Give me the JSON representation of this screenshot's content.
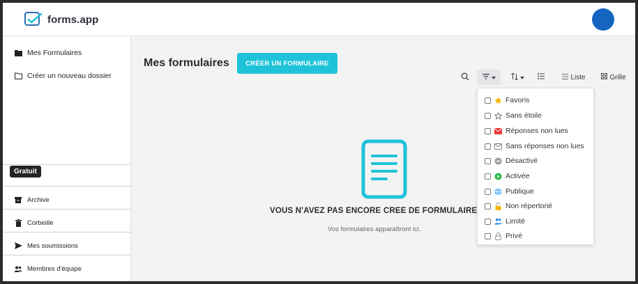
{
  "header": {
    "logo_text": "forms.app",
    "logo_icon": "forms-app-logo-icon"
  },
  "sidebar": {
    "items_top": [
      {
        "label": "Mes Formulaires",
        "icon": "folder-filled-icon"
      },
      {
        "label": "Créer un nouveau dossier",
        "icon": "folder-outline-icon"
      }
    ],
    "plan_badge": "Gratuit",
    "items_bottom": [
      {
        "label": "Archive",
        "icon": "archive-icon"
      },
      {
        "label": "Corbeille",
        "icon": "trash-icon"
      },
      {
        "label": "Mes soumissions",
        "icon": "send-icon"
      },
      {
        "label": "Membres d'équipe",
        "icon": "team-icon"
      }
    ]
  },
  "main": {
    "title": "Mes formulaires",
    "create_button": "CRÉER UN FORMULAIRE",
    "toolbar": {
      "search_icon": "search-icon",
      "filter_icon": "filter-icon",
      "sort_icon": "sort-icon",
      "list_label": "Liste",
      "grid_label": "Grille"
    },
    "empty_state": {
      "title": "VOUS N'AVEZ PAS ENCORE CRÉÉ DE FORMULAIRE",
      "subtitle": "Vos formulaires apparaîtront ici.",
      "icon": "document-icon"
    }
  },
  "filter_menu": {
    "items": [
      {
        "label": "Favoris",
        "icon": "star-filled-icon"
      },
      {
        "label": "Sans étoile",
        "icon": "star-outline-icon"
      },
      {
        "label": "Réponses non lues",
        "icon": "mail-unread-icon"
      },
      {
        "label": "Sans réponses non lues",
        "icon": "mail-read-icon"
      },
      {
        "label": "Désactivé",
        "icon": "disabled-icon"
      },
      {
        "label": "Activée",
        "icon": "active-icon"
      },
      {
        "label": "Publique",
        "icon": "globe-icon"
      },
      {
        "label": "Non répertorié",
        "icon": "unlisted-lock-icon"
      },
      {
        "label": "Limité",
        "icon": "limited-people-icon"
      },
      {
        "label": "Privé",
        "icon": "private-lock-icon"
      }
    ]
  },
  "colors": {
    "accent": "#1fc3d9",
    "avatar": "#1565c0"
  }
}
